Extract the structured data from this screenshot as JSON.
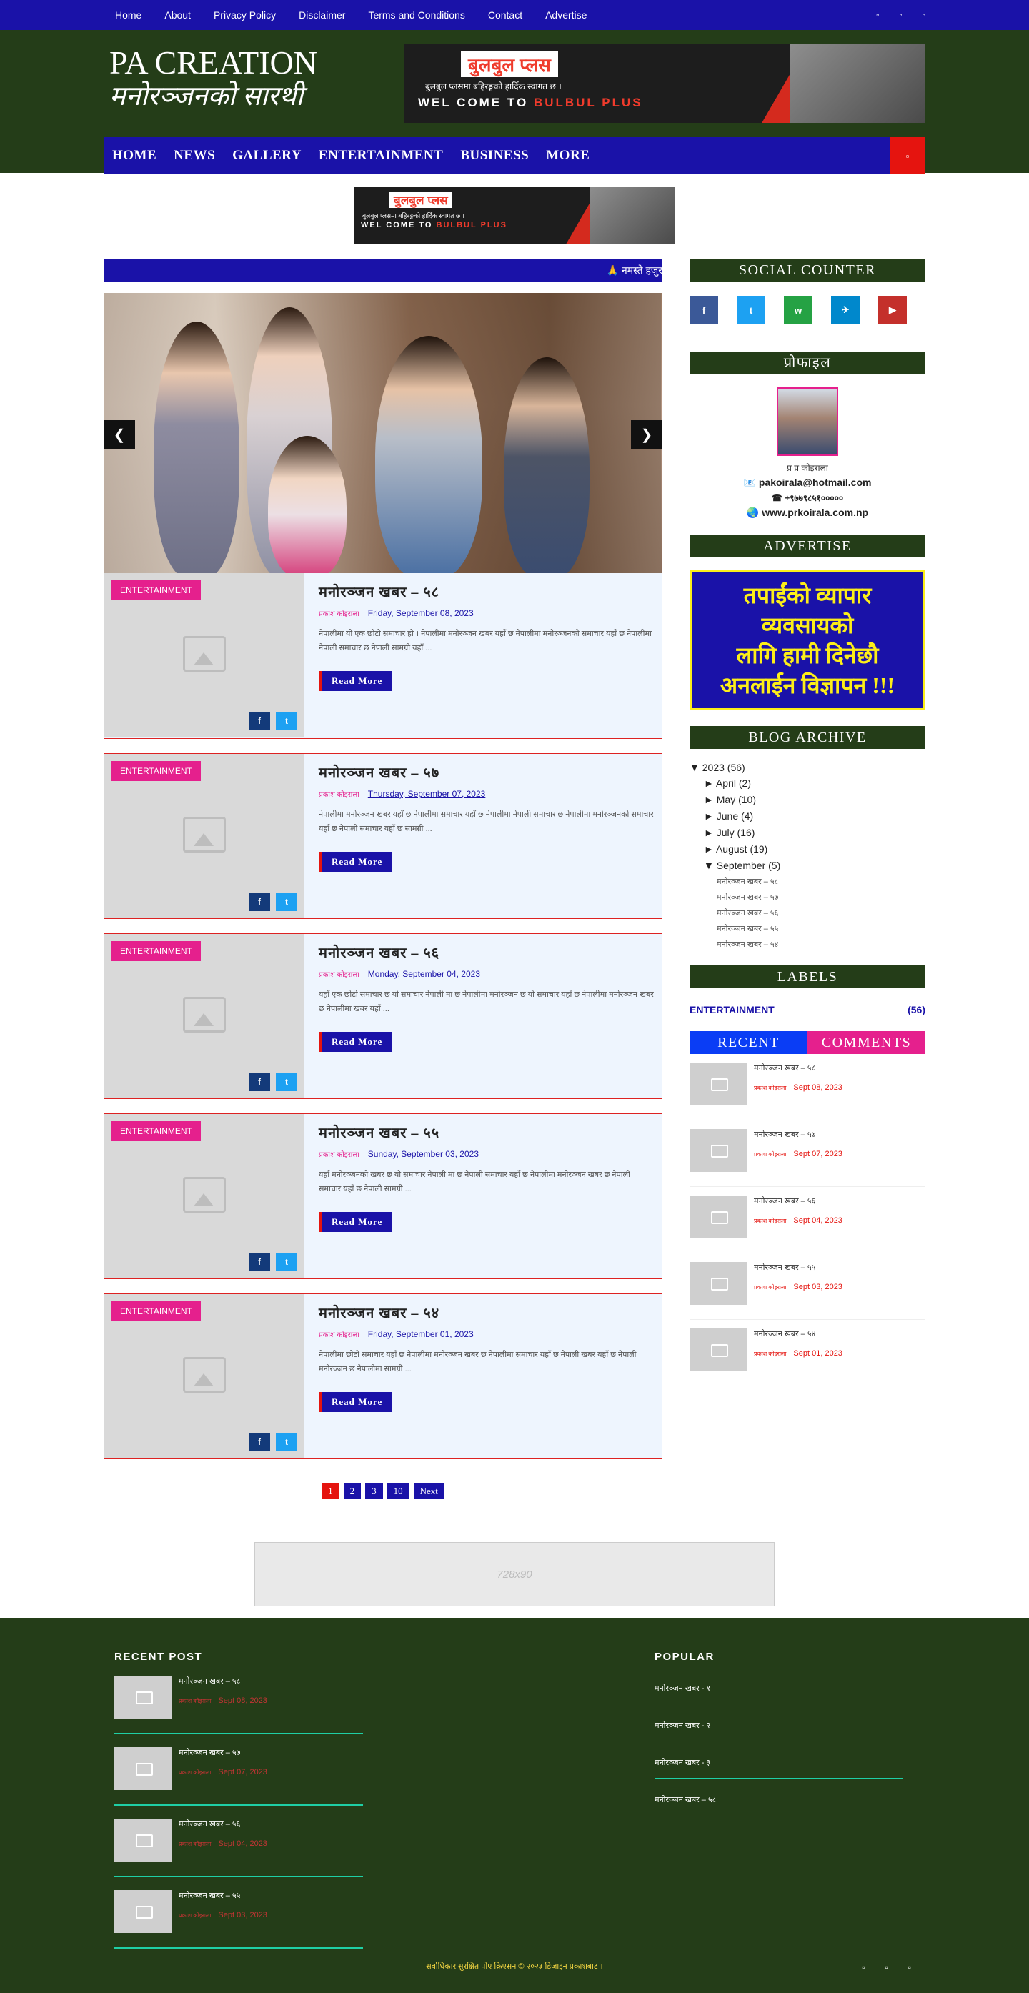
{
  "topbar": {
    "links": [
      "Home",
      "About",
      "Privacy Policy",
      "Disclaimer",
      "Terms and Conditions",
      "Contact",
      "Advertise"
    ],
    "social_icons": [
      "facebook-icon",
      "twitter-icon",
      "youtube-icon"
    ]
  },
  "header": {
    "logo_line1": "PA CREATION",
    "logo_line2": "मनोरञ्जनको सारथी",
    "banner_title": "बुलबुल प्लस",
    "banner_sub": "बुलबुल प्लसमा बहिरङ्गको हार्दिक स्वागत छ ।",
    "banner_welcome_a": "WEL COME TO ",
    "banner_welcome_b": "BULBUL PLUS"
  },
  "mainnav": {
    "items": [
      "HOME",
      "NEWS",
      "GALLERY",
      "ENTERTAINMENT",
      "BUSINESS",
      "MORE"
    ],
    "search_icon": "search-icon"
  },
  "ticker": {
    "text": "🙏 नमस्ते हजुर"
  },
  "slider": {
    "prev": "❮",
    "next": "❯"
  },
  "posts": [
    {
      "category": "ENTERTAINMENT",
      "title": "मनोरञ्जन खबर – ५८",
      "author": "प्रकाश कोइराला",
      "date": "Friday, September 08, 2023",
      "excerpt": "नेपालीमा यो एक छोटो समाचार हो । नेपालीमा मनोरञ्जन खबर यहाँ छ नेपालीमा मनोरञ्जनको समाचार यहाँ छ नेपालीमा नेपाली समाचार छ नेपाली सामग्री यहाँ ...",
      "read_more": "Read More"
    },
    {
      "category": "ENTERTAINMENT",
      "title": "मनोरञ्जन खबर – ५७",
      "author": "प्रकाश कोइराला",
      "date": "Thursday, September 07, 2023",
      "excerpt": "नेपालीमा मनोरञ्जन खबर यहाँ छ नेपालीमा समाचार यहाँ छ नेपालीमा नेपाली समाचार छ नेपालीमा मनोरञ्जनको समाचार यहाँ छ नेपाली समाचार यहाँ छ सामग्री ...",
      "read_more": "Read More"
    },
    {
      "category": "ENTERTAINMENT",
      "title": "मनोरञ्जन खबर – ५६",
      "author": "प्रकाश कोइराला",
      "date": "Monday, September 04, 2023",
      "excerpt": "यहाँ एक छोटो समाचार छ यो समाचार नेपाली मा छ नेपालीमा मनोरञ्जन छ यो समाचार यहाँ छ नेपालीमा मनोरञ्जन खबर छ नेपालीमा खबर यहाँ ...",
      "read_more": "Read More"
    },
    {
      "category": "ENTERTAINMENT",
      "title": "मनोरञ्जन खबर – ५५",
      "author": "प्रकाश कोइराला",
      "date": "Sunday, September 03, 2023",
      "excerpt": "यहाँ मनोरञ्जनको खबर छ यो समाचार नेपाली मा छ नेपाली समाचार यहाँ छ नेपालीमा मनोरञ्जन खबर छ नेपाली समाचार यहाँ छ नेपाली सामग्री ...",
      "read_more": "Read More"
    },
    {
      "category": "ENTERTAINMENT",
      "title": "मनोरञ्जन खबर – ५४",
      "author": "प्रकाश कोइराला",
      "date": "Friday, September 01, 2023",
      "excerpt": "नेपालीमा छोटो समाचार यहाँ छ नेपालीमा मनोरञ्जन खबर छ नेपालीमा समाचार यहाँ छ नेपाली खबर यहाँ छ नेपाली मनोरञ्जन छ नेपालीमा सामग्री ...",
      "read_more": "Read More"
    }
  ],
  "pager": [
    "1",
    "2",
    "3",
    "10",
    "Next"
  ],
  "sidebar": {
    "social_title": "SOCIAL COUNTER",
    "social_icons": [
      {
        "name": "facebook-icon",
        "glyph": "f",
        "color": "#3b5998"
      },
      {
        "name": "twitter-icon",
        "glyph": "t",
        "color": "#1da1f2"
      },
      {
        "name": "whatsapp-icon",
        "glyph": "w",
        "color": "#25a244"
      },
      {
        "name": "telegram-icon",
        "glyph": "✈",
        "color": "#0088cc"
      },
      {
        "name": "youtube-icon",
        "glyph": "▶",
        "color": "#c4302b"
      }
    ],
    "profile_title": "प्रोफाइल",
    "profile_name": "प्र प्र कोइराला",
    "profile_email": "📧 pakoirala@hotmail.com",
    "profile_phone": "☎ +९७७९८५१०००००",
    "profile_web": "🌏 www.prkoirala.com.np",
    "advertise_title": "ADVERTISE",
    "ad_lines": [
      "तपाईंको व्यापार",
      "व्यवसायको",
      "लागि हामी दिनेछौ",
      "अनलाईन विज्ञापन !!!"
    ],
    "archive_title": "BLOG ARCHIVE",
    "archive_year": "▼  2023 (56)",
    "archive_months": [
      "►  April (2)",
      "►  May (10)",
      "►  June (4)",
      "►  July (16)",
      "►  August (19)",
      "▼  September (5)"
    ],
    "archive_posts": [
      "मनोरञ्जन खबर – ५८",
      "मनोरञ्जन खबर – ५७",
      "मनोरञ्जन खबर – ५६",
      "मनोरञ्जन खबर – ५५",
      "मनोरञ्जन खबर – ५४"
    ],
    "labels_title": "LABELS",
    "label_name": " ENTERTAINMENT",
    "label_count": "(56)",
    "tab_recent": "RECENT",
    "tab_comments": "COMMENTS",
    "recent": [
      {
        "title": "मनोरञ्जन खबर – ५८",
        "author": "प्रकाश कोइराला",
        "date": "Sept 08, 2023"
      },
      {
        "title": "मनोरञ्जन खबर – ५७",
        "author": "प्रकाश कोइराला",
        "date": "Sept 07, 2023"
      },
      {
        "title": "मनोरञ्जन खबर – ५६",
        "author": "प्रकाश कोइराला",
        "date": "Sept 04, 2023"
      },
      {
        "title": "मनोरञ्जन खबर – ५५",
        "author": "प्रकाश कोइराला",
        "date": "Sept 03, 2023"
      },
      {
        "title": "मनोरञ्जन खबर – ५४",
        "author": "प्रकाश कोइराला",
        "date": "Sept 01, 2023"
      }
    ]
  },
  "ad728": {
    "text": "728x90"
  },
  "footer": {
    "recent_title": "RECENT POST",
    "recent": [
      {
        "title": "मनोरञ्जन खबर – ५८",
        "author": "प्रकाश कोइराला",
        "date": "Sept 08, 2023"
      },
      {
        "title": "मनोरञ्जन खबर – ५७",
        "author": "प्रकाश कोइराला",
        "date": "Sept 07, 2023"
      },
      {
        "title": "मनोरञ्जन खबर – ५६",
        "author": "प्रकाश कोइराला",
        "date": "Sept 04, 2023"
      },
      {
        "title": "मनोरञ्जन खबर – ५५",
        "author": "प्रकाश कोइराला",
        "date": "Sept 03, 2023"
      }
    ],
    "popular_title": "POPULAR",
    "popular": [
      "मनोरञ्जन खबर - १",
      "मनोरञ्जन खबर - २",
      "मनोरञ्जन खबर - ३",
      "मनोरञ्जन खबर – ५८"
    ],
    "copyright": "सर्वाधिकार सुरक्षित पीए क्रिएसन © २०२३ डिजाइन प्रकाशबाट ।",
    "social_icons": [
      "facebook-icon",
      "twitter-icon",
      "youtube-icon"
    ]
  }
}
